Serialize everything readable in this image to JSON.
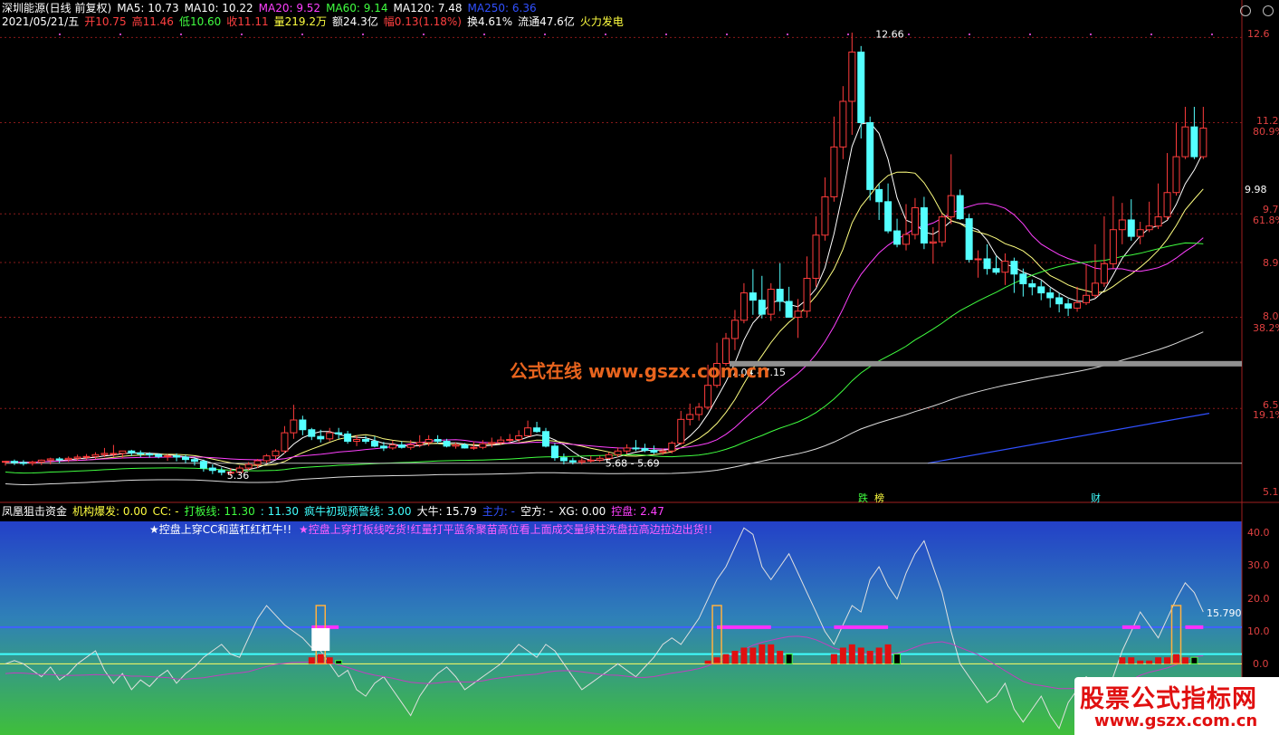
{
  "main_header": {
    "line1": [
      {
        "text": "深圳能源(日线 前复权)",
        "color": "#ffffff"
      },
      {
        "text": "MA5: 10.73",
        "color": "#ffffff"
      },
      {
        "text": "MA10: 10.22",
        "color": "#ffffff"
      },
      {
        "text": "MA20: 9.52",
        "color": "#ff40ff"
      },
      {
        "text": "MA60: 9.14",
        "color": "#40ff40"
      },
      {
        "text": "MA120: 7.48",
        "color": "#ffffff"
      },
      {
        "text": "MA250: 6.36",
        "color": "#3050ff"
      }
    ],
    "line2": [
      {
        "text": "2021/05/21/五",
        "color": "#ffffff"
      },
      {
        "text": "开10.75",
        "color": "#ff4040"
      },
      {
        "text": "高11.46",
        "color": "#ff4040"
      },
      {
        "text": "低10.60",
        "color": "#40ff40"
      },
      {
        "text": "收11.11",
        "color": "#ff4040"
      },
      {
        "text": "量219.2万",
        "color": "#ffff40"
      },
      {
        "text": "额24.3亿",
        "color": "#ffffff"
      },
      {
        "text": "幅0.13(1.18%)",
        "color": "#ff4040"
      },
      {
        "text": "换4.61%",
        "color": "#ffffff"
      },
      {
        "text": "流通47.6亿",
        "color": "#ffffff"
      },
      {
        "text": "火力发电",
        "color": "#ffff40"
      }
    ]
  },
  "price_axis": {
    "labels": [
      "12.6",
      "11.2",
      "9.98",
      "9.7",
      "8.9",
      "8.0",
      "6.5",
      "5.1"
    ],
    "pct_labels": [
      "80.9%",
      "61.8%",
      "38.2%",
      "19.1%"
    ]
  },
  "watermark": "公式在线  www.gszx.com.cn",
  "markers": {
    "die": "跌",
    "bang": "榜",
    "cai": "财"
  },
  "sub_header": [
    {
      "text": "凤凰狙击资金",
      "color": "#ffffff"
    },
    {
      "text": "机构爆发: 0.00",
      "color": "#ffff40"
    },
    {
      "text": "CC: -",
      "color": "#ffff40"
    },
    {
      "text": "打板线: 11.30",
      "color": "#40ff40"
    },
    {
      "text": ": 11.30",
      "color": "#40ffff"
    },
    {
      "text": "疯牛初现预警线: 3.00",
      "color": "#40ffff"
    },
    {
      "text": "大牛: 15.79",
      "color": "#ffffff"
    },
    {
      "text": "主力: -",
      "color": "#3050ff"
    },
    {
      "text": "空方: -",
      "color": "#ffffff"
    },
    {
      "text": "XG: 0.00",
      "color": "#ffffff"
    },
    {
      "text": "控盘: 2.47",
      "color": "#ff40ff"
    }
  ],
  "sub_notes": {
    "left": "★控盘上穿CC和蓝杠红杠牛!!",
    "right": "★控盘上穿打板线吃货!红量打平蓝条聚苗高位看上面成交量绿柱洗盘拉高边拉边出货!!"
  },
  "sub_axis": {
    "labels": [
      "40.0",
      "30.0",
      "20.0",
      "10.0",
      "0.0"
    ]
  },
  "corner_ad": {
    "line1": "股票公式指标网",
    "line2": "www.gszx.com.cn"
  },
  "chart_data": [
    {
      "type": "candlestick",
      "title": "深圳能源(日线 前复权)",
      "ylim": [
        5.0,
        12.8
      ],
      "x": [
        0,
        1,
        2,
        3,
        4,
        5,
        6,
        7,
        8,
        9,
        10,
        11,
        12,
        13,
        14,
        15,
        16,
        17,
        18,
        19,
        20,
        21,
        22,
        23,
        24,
        25,
        26,
        27,
        28,
        29,
        30,
        31,
        32,
        33,
        34,
        35,
        36,
        37,
        38,
        39,
        40,
        41,
        42,
        43,
        44,
        45,
        46,
        47,
        48,
        49,
        50,
        51,
        52,
        53,
        54,
        55,
        56,
        57,
        58,
        59,
        60,
        61,
        62,
        63,
        64,
        65,
        66,
        67,
        68,
        69,
        70,
        71,
        72,
        73,
        74,
        75,
        76,
        77,
        78,
        79,
        80,
        81,
        82,
        83,
        84,
        85,
        86,
        87,
        88,
        89,
        90,
        91,
        92,
        93,
        94,
        95,
        96,
        97,
        98,
        99,
        100,
        101,
        102,
        103,
        104,
        105,
        106,
        107,
        108,
        109,
        110,
        111,
        112,
        113,
        114,
        115,
        116,
        117,
        118,
        119,
        120,
        121,
        122,
        123,
        124,
        125,
        126,
        127,
        128,
        129,
        130,
        131,
        132,
        133
      ],
      "series": [
        {
          "name": "open",
          "values": [
            5.62,
            5.63,
            5.61,
            5.6,
            5.62,
            5.65,
            5.67,
            5.66,
            5.68,
            5.7,
            5.71,
            5.74,
            5.76,
            5.76,
            5.8,
            5.77,
            5.75,
            5.74,
            5.71,
            5.72,
            5.7,
            5.66,
            5.63,
            5.52,
            5.48,
            5.45,
            5.45,
            5.52,
            5.58,
            5.64,
            5.72,
            5.8,
            6.1,
            6.31,
            6.15,
            6.04,
            6.0,
            6.1,
            6.08,
            5.96,
            5.99,
            5.96,
            5.88,
            5.85,
            5.9,
            5.86,
            5.9,
            5.94,
            5.99,
            5.96,
            5.88,
            5.9,
            5.85,
            5.86,
            5.92,
            5.94,
            5.98,
            5.99,
            6.05,
            6.18,
            6.12,
            5.88,
            5.69,
            5.64,
            5.62,
            5.64,
            5.65,
            5.68,
            5.74,
            5.8,
            5.85,
            5.84,
            5.81,
            5.78,
            5.8,
            5.93,
            6.32,
            6.4,
            6.52,
            6.88,
            7.24,
            7.65,
            7.95,
            8.4,
            8.28,
            8.05,
            8.46,
            8.26,
            8.0,
            8.1,
            8.64,
            9.35,
            9.98,
            10.8,
            11.55,
            12.36,
            11.2,
            10.1,
            9.9,
            9.42,
            9.2,
            9.36,
            9.8,
            9.22,
            9.24,
            9.65,
            10.0,
            9.62,
            8.95,
            8.96,
            8.8,
            8.74,
            8.92,
            8.71,
            8.55,
            8.5,
            8.4,
            8.32,
            8.22,
            8.15,
            8.24,
            8.36,
            8.56,
            8.88,
            9.44,
            9.6,
            9.33,
            9.44,
            9.5,
            9.65,
            10.05,
            10.64,
            11.13,
            10.64
          ]
        },
        {
          "name": "high",
          "values": [
            5.64,
            5.66,
            5.65,
            5.64,
            5.66,
            5.69,
            5.7,
            5.71,
            5.74,
            5.75,
            5.78,
            5.85,
            5.9,
            5.8,
            5.82,
            5.81,
            5.78,
            5.76,
            5.75,
            5.76,
            5.74,
            5.7,
            5.66,
            5.58,
            5.53,
            5.52,
            5.56,
            5.62,
            5.67,
            5.75,
            5.83,
            6.21,
            6.56,
            6.38,
            6.18,
            6.15,
            6.18,
            6.18,
            6.13,
            6.06,
            6.05,
            6.04,
            5.95,
            5.97,
            5.96,
            5.98,
            6.06,
            6.06,
            6.06,
            6.0,
            5.94,
            5.93,
            5.96,
            5.98,
            6.02,
            6.04,
            6.08,
            6.14,
            6.3,
            6.28,
            6.18,
            5.93,
            5.76,
            5.69,
            5.68,
            5.72,
            5.72,
            5.78,
            5.86,
            5.91,
            5.98,
            5.92,
            5.89,
            5.84,
            5.96,
            6.46,
            6.58,
            6.59,
            7.22,
            7.58,
            7.74,
            8.12,
            8.56,
            8.79,
            8.68,
            8.56,
            8.89,
            8.5,
            8.3,
            9.0,
            9.66,
            10.3,
            11.3,
            11.8,
            12.68,
            12.46,
            11.3,
            10.2,
            10.2,
            9.62,
            9.86,
            9.96,
            9.98,
            9.48,
            9.7,
            10.68,
            10.1,
            9.7,
            9.1,
            9.2,
            9.0,
            9.05,
            8.98,
            8.8,
            8.62,
            8.6,
            8.48,
            8.4,
            8.3,
            8.5,
            8.86,
            9.2,
            9.66,
            9.99,
            9.88,
            9.94,
            9.57,
            9.9,
            10.2,
            10.7,
            11.2,
            11.46,
            11.46,
            11.46
          ]
        },
        {
          "name": "low",
          "values": [
            5.56,
            5.57,
            5.56,
            5.56,
            5.57,
            5.58,
            5.6,
            5.62,
            5.64,
            5.66,
            5.67,
            5.7,
            5.7,
            5.68,
            5.72,
            5.7,
            5.69,
            5.68,
            5.64,
            5.63,
            5.6,
            5.56,
            5.46,
            5.42,
            5.4,
            5.39,
            5.42,
            5.48,
            5.52,
            5.6,
            5.66,
            5.76,
            6.0,
            6.06,
            5.98,
            5.94,
            5.96,
            6.0,
            5.92,
            5.88,
            5.92,
            5.86,
            5.8,
            5.82,
            5.84,
            5.82,
            5.86,
            5.88,
            5.92,
            5.86,
            5.84,
            5.84,
            5.82,
            5.83,
            5.86,
            5.9,
            5.94,
            5.95,
            6.04,
            6.1,
            5.86,
            5.64,
            5.58,
            5.58,
            5.58,
            5.61,
            5.62,
            5.66,
            5.7,
            5.75,
            5.8,
            5.78,
            5.75,
            5.74,
            5.76,
            5.9,
            6.22,
            6.3,
            6.48,
            6.84,
            7.2,
            7.46,
            7.9,
            8.04,
            7.98,
            7.94,
            8.1,
            8.0,
            7.66,
            8.0,
            8.5,
            9.26,
            9.9,
            10.6,
            11.0,
            10.94,
            9.92,
            9.6,
            9.38,
            9.15,
            9.1,
            9.28,
            9.12,
            8.88,
            9.16,
            9.53,
            9.6,
            8.9,
            8.65,
            8.7,
            8.7,
            8.53,
            8.4,
            8.34,
            8.36,
            8.28,
            8.16,
            8.08,
            8.02,
            8.09,
            8.2,
            8.32,
            8.5,
            8.8,
            9.2,
            9.26,
            9.2,
            9.4,
            9.45,
            9.6,
            10.0,
            10.6,
            10.6,
            10.6
          ]
        },
        {
          "name": "close",
          "values": [
            5.63,
            5.61,
            5.6,
            5.62,
            5.65,
            5.67,
            5.66,
            5.68,
            5.7,
            5.71,
            5.74,
            5.76,
            5.76,
            5.8,
            5.77,
            5.75,
            5.74,
            5.71,
            5.72,
            5.7,
            5.66,
            5.63,
            5.52,
            5.48,
            5.45,
            5.45,
            5.52,
            5.58,
            5.64,
            5.72,
            5.8,
            6.1,
            6.31,
            6.15,
            6.04,
            6.0,
            6.1,
            6.08,
            5.96,
            5.99,
            5.96,
            5.88,
            5.85,
            5.9,
            5.86,
            5.9,
            5.94,
            5.99,
            5.96,
            5.88,
            5.9,
            5.85,
            5.86,
            5.92,
            5.94,
            5.98,
            5.99,
            6.05,
            6.18,
            6.12,
            5.88,
            5.69,
            5.64,
            5.62,
            5.64,
            5.65,
            5.68,
            5.74,
            5.8,
            5.85,
            5.84,
            5.81,
            5.78,
            5.8,
            5.93,
            6.32,
            6.4,
            6.52,
            6.88,
            7.24,
            7.65,
            7.95,
            8.4,
            8.28,
            8.05,
            8.46,
            8.26,
            8.0,
            8.1,
            8.64,
            9.35,
            9.98,
            10.8,
            11.55,
            12.36,
            11.2,
            10.1,
            9.9,
            9.42,
            9.2,
            9.36,
            9.8,
            9.22,
            9.24,
            9.65,
            10.0,
            9.62,
            8.95,
            8.96,
            8.8,
            8.74,
            8.92,
            8.71,
            8.55,
            8.5,
            8.4,
            8.32,
            8.22,
            8.15,
            8.24,
            8.36,
            8.56,
            8.88,
            9.44,
            9.6,
            9.33,
            9.44,
            9.5,
            9.65,
            10.05,
            10.64,
            11.13,
            10.64,
            11.11
          ]
        }
      ],
      "annotations": [
        {
          "text": "5.36",
          "x": 24,
          "y": 5.4
        },
        {
          "text": "5.68 - 5.69",
          "x": 66,
          "y": 5.6
        },
        {
          "text": "7.04 - 7.15",
          "x": 80,
          "y": 7.1
        },
        {
          "text": "12.66",
          "x": 96,
          "y": 12.66
        }
      ]
    },
    {
      "type": "line",
      "title": "凤凰狙击资金",
      "ylim": [
        -22,
        44
      ],
      "series": [
        {
          "name": "大牛",
          "last_value": 15.79
        },
        {
          "name": "打板线",
          "constant": 11.3
        },
        {
          "name": "疯牛初现预警线",
          "constant": 3.0
        }
      ],
      "annotations": [
        {
          "text": "15.790"
        }
      ]
    }
  ]
}
